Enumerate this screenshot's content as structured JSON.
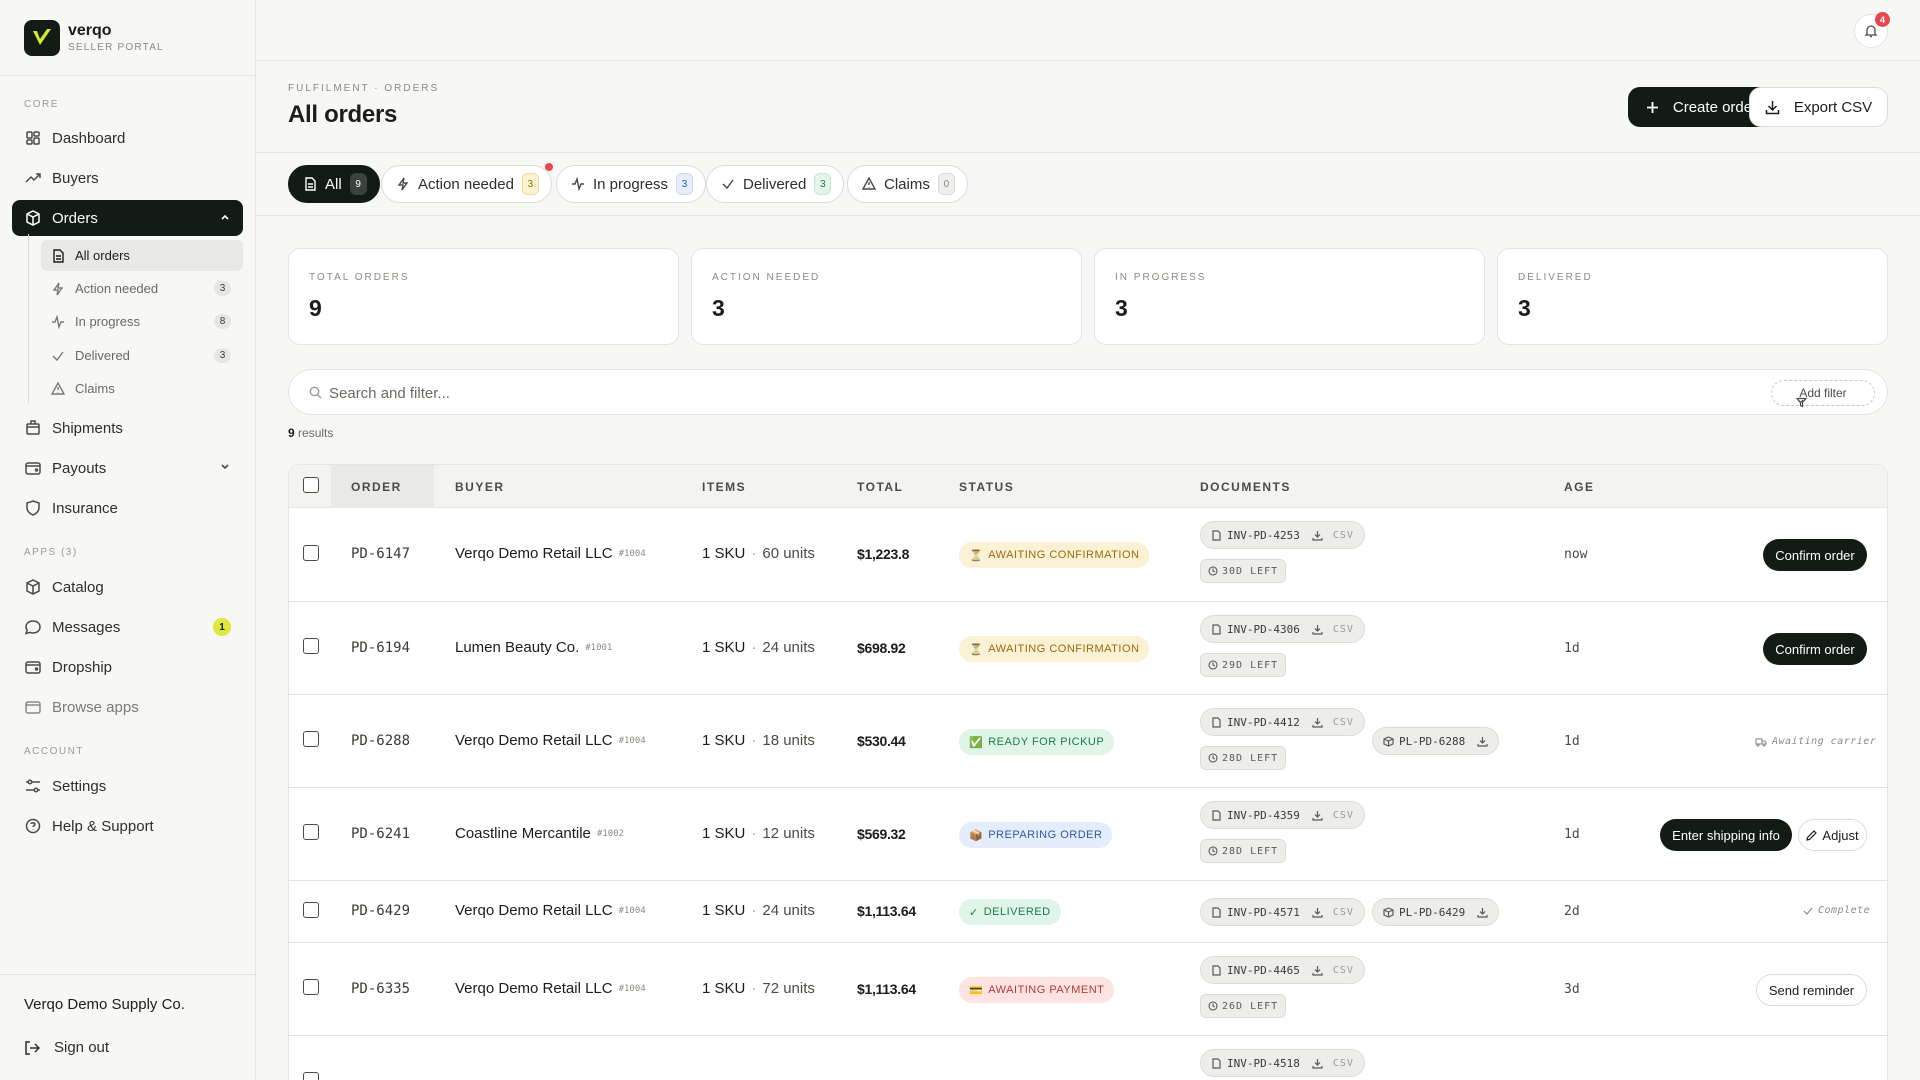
{
  "brand": {
    "name": "verqo",
    "subtitle": "SELLER PORTAL"
  },
  "sidebar": {
    "core_label": "CORE",
    "apps_label": "APPS (3)",
    "account_label": "ACCOUNT",
    "nav": {
      "dashboard": "Dashboard",
      "buyers": "Buyers",
      "orders": "Orders",
      "shipments": "Shipments",
      "payouts": "Payouts",
      "insurance": "Insurance",
      "catalog": "Catalog",
      "messages": "Messages",
      "messages_badge": "1",
      "dropship": "Dropship",
      "browse_apps": "Browse apps",
      "settings": "Settings",
      "help": "Help & Support"
    },
    "orders_sub": [
      {
        "label": "All orders",
        "count": ""
      },
      {
        "label": "Action needed",
        "count": "3"
      },
      {
        "label": "In progress",
        "count": "8"
      },
      {
        "label": "Delivered",
        "count": "3"
      },
      {
        "label": "Claims",
        "count": ""
      }
    ],
    "company": "Verqo Demo Supply Co.",
    "sign_out": "Sign out"
  },
  "topbar": {
    "notification_count": "4"
  },
  "header": {
    "breadcrumb": "FULFILMENT · ORDERS",
    "title": "All orders",
    "create_label": "Create order",
    "export_label": "Export CSV"
  },
  "tabs": [
    {
      "label": "All",
      "count": "9"
    },
    {
      "label": "Action needed",
      "count": "3"
    },
    {
      "label": "In progress",
      "count": "3"
    },
    {
      "label": "Delivered",
      "count": "3"
    },
    {
      "label": "Claims",
      "count": "0"
    }
  ],
  "stats": [
    {
      "label": "TOTAL ORDERS",
      "value": "9"
    },
    {
      "label": "ACTION NEEDED",
      "value": "3"
    },
    {
      "label": "IN PROGRESS",
      "value": "3"
    },
    {
      "label": "DELIVERED",
      "value": "3"
    }
  ],
  "search": {
    "placeholder": "Search and filter...",
    "add_filter": "Add filter"
  },
  "results": {
    "count": "9",
    "label": "results"
  },
  "table": {
    "columns": {
      "order": "ORDER",
      "buyer": "BUYER",
      "items": "ITEMS",
      "total": "TOTAL",
      "status": "STATUS",
      "documents": "DOCUMENTS",
      "age": "AGE"
    },
    "rows": [
      {
        "order": "PD-6147",
        "buyer": "Verqo Demo Retail LLC",
        "buyer_id": "#1004",
        "sku": "1 SKU",
        "units": "60 units",
        "total": "$1,223.8",
        "status_icon": "⏳",
        "status": "AWAITING CONFIRMATION",
        "invoice": "INV-PD-4253",
        "csv": "CSV",
        "deadline": "30D LEFT",
        "age": "now",
        "action": "Confirm order"
      },
      {
        "order": "PD-6194",
        "buyer": "Lumen Beauty Co.",
        "buyer_id": "#1001",
        "sku": "1 SKU",
        "units": "24 units",
        "total": "$698.92",
        "status_icon": "⏳",
        "status": "AWAITING CONFIRMATION",
        "invoice": "INV-PD-4306",
        "csv": "CSV",
        "deadline": "29D LEFT",
        "age": "1d",
        "action": "Confirm order"
      },
      {
        "order": "PD-6288",
        "buyer": "Verqo Demo Retail LLC",
        "buyer_id": "#1004",
        "sku": "1 SKU",
        "units": "18 units",
        "total": "$530.44",
        "status_icon": "✅",
        "status": "READY FOR PICKUP",
        "invoice": "INV-PD-4412",
        "csv": "CSV",
        "deadline": "28D LEFT",
        "packing_list": "PL-PD-6288",
        "age": "1d",
        "note": "Awaiting carrier"
      },
      {
        "order": "PD-6241",
        "buyer": "Coastline Mercantile",
        "buyer_id": "#1002",
        "sku": "1 SKU",
        "units": "12 units",
        "total": "$569.32",
        "status_icon": "📦",
        "status": "PREPARING ORDER",
        "invoice": "INV-PD-4359",
        "csv": "CSV",
        "deadline": "28D LEFT",
        "age": "1d",
        "action": "Enter shipping info",
        "action2": "Adjust"
      },
      {
        "order": "PD-6429",
        "buyer": "Verqo Demo Retail LLC",
        "buyer_id": "#1004",
        "sku": "1 SKU",
        "units": "24 units",
        "total": "$1,113.64",
        "status_icon": "✓",
        "status": "DELIVERED",
        "invoice": "INV-PD-4571",
        "csv": "CSV",
        "packing_list": "PL-PD-6429",
        "age": "2d",
        "note": "Complete"
      },
      {
        "order": "PD-6335",
        "buyer": "Verqo Demo Retail LLC",
        "buyer_id": "#1004",
        "sku": "1 SKU",
        "units": "72 units",
        "total": "$1,113.64",
        "status_icon": "💳",
        "status": "AWAITING PAYMENT",
        "invoice": "INV-PD-4465",
        "csv": "CSV",
        "deadline": "26D LEFT",
        "age": "3d",
        "action": "Send reminder"
      },
      {
        "invoice": "INV-PD-4518",
        "csv": "CSV"
      }
    ]
  },
  "colors": {
    "accent_dark": "#121c15",
    "badge_yellow": "#e0e840",
    "alert_red": "#e5484d"
  }
}
